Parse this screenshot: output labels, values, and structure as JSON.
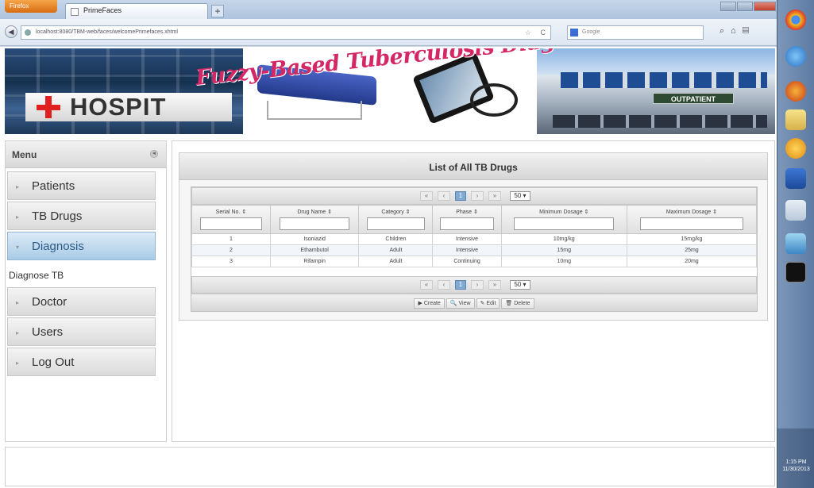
{
  "browser": {
    "app_button": "Firefox",
    "tab_title": "PrimeFaces",
    "new_tab": "+",
    "url": "localhost:8080/TBM-web/faces/welcomePrimefaces.xhtml",
    "search_placeholder": "Google",
    "back": "◀",
    "star": "☆",
    "reload": "C",
    "nav_icons": "⌕⌂▤"
  },
  "banner": {
    "hospital_sign": "HOSPIT",
    "outpatient_sign": "OUTPATIENT",
    "title": "Fuzzy-Based Tuberculosis Diagnosis System"
  },
  "menu": {
    "title": "Menu",
    "collapse": "◂",
    "items": [
      {
        "label": "Patients",
        "bullet": "▸"
      },
      {
        "label": "TB Drugs",
        "bullet": "▸"
      },
      {
        "label": "Diagnosis",
        "bullet": "▾"
      },
      {
        "label": "Doctor",
        "bullet": "▸"
      },
      {
        "label": "Users",
        "bullet": "▸"
      },
      {
        "label": "Log Out",
        "bullet": "▸"
      }
    ],
    "sub_item": "Diagnose TB"
  },
  "panel": {
    "title": "List of All TB Drugs",
    "pager": {
      "first": "«",
      "prev": "‹",
      "current": "1",
      "next": "›",
      "last": "»",
      "rows_select": "50 ▾"
    },
    "columns": [
      "Serial No. ⇕",
      "Drug Name ⇕",
      "Category ⇕",
      "Phase ⇕",
      "Minimum Dosage ⇕",
      "Maximum Dosage ⇕"
    ],
    "rows": [
      [
        "1",
        "Isoniazid",
        "Children",
        "Intensive",
        "10mg/kg",
        "15mg/kg"
      ],
      [
        "2",
        "Ethambutol",
        "Adult",
        "Intensive",
        "15mg",
        "25mg"
      ],
      [
        "3",
        "Rifampin",
        "Adult",
        "Continuing",
        "10mg",
        "20mg"
      ]
    ],
    "actions": [
      "▶ Create",
      "🔍 View",
      "✎ Edit",
      "🗑 Delete"
    ]
  },
  "taskbar": {
    "icons": [
      "chrome-icon",
      "ie-icon",
      "firefox-icon",
      "folder-icon",
      "media-icon",
      "word-icon",
      "shield-icon",
      "paint-icon",
      "terminal-icon"
    ],
    "clock_time": "1:15 PM",
    "clock_date": "11/30/2013"
  },
  "colors": {
    "accent": "#a9cbe6",
    "banner_title": "#d42766"
  }
}
